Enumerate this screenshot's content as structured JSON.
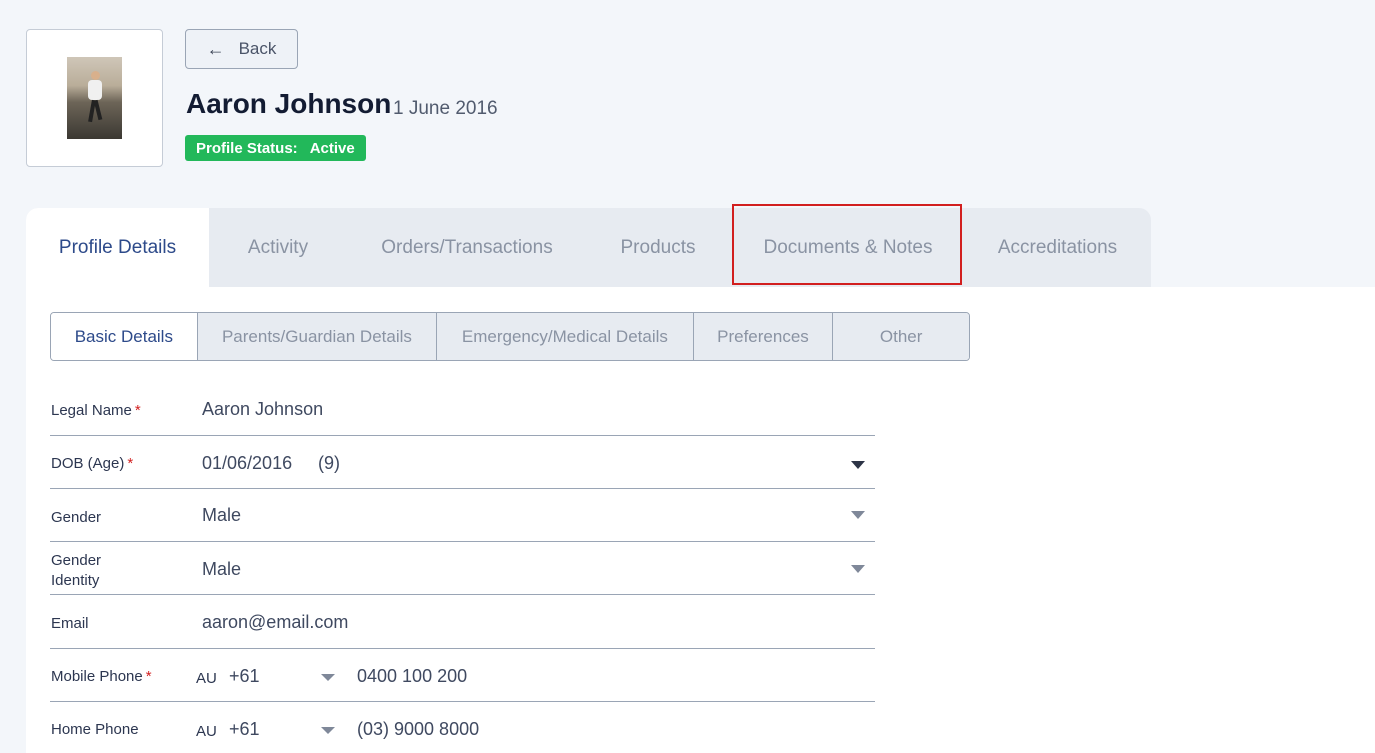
{
  "header": {
    "back_label": "Back",
    "name": "Aaron Johnson",
    "date": "1 June 2016",
    "status_label": "Profile Status:",
    "status_value": "Active",
    "status_color": "#22b85a"
  },
  "tabs": [
    {
      "label": "Profile Details",
      "active": true
    },
    {
      "label": "Activity"
    },
    {
      "label": "Orders/Transactions"
    },
    {
      "label": "Products"
    },
    {
      "label": "Documents & Notes",
      "highlighted": true
    },
    {
      "label": "Accreditations"
    }
  ],
  "subtabs": [
    {
      "label": "Basic Details",
      "active": true
    },
    {
      "label": "Parents/Guardian Details"
    },
    {
      "label": "Emergency/Medical Details"
    },
    {
      "label": "Preferences"
    },
    {
      "label": "Other"
    }
  ],
  "form": {
    "legal_name": {
      "label": "Legal Name",
      "value": "Aaron Johnson"
    },
    "dob": {
      "label": "DOB (Age)",
      "value": "01/06/2016",
      "age": "(9)"
    },
    "gender": {
      "label": "Gender",
      "value": "Male"
    },
    "gender_identity": {
      "label_line1": "Gender",
      "label_line2": "Identity",
      "value": "Male"
    },
    "email": {
      "label": "Email",
      "value": "aaron@email.com"
    },
    "mobile": {
      "label": "Mobile Phone",
      "country": "AU",
      "code": "+61",
      "number": "0400 100 200"
    },
    "home": {
      "label": "Home Phone",
      "country": "AU",
      "code": "+61",
      "number": "(03) 9000 8000"
    }
  },
  "required_mark": "*",
  "highlight_color": "#d21f1f"
}
